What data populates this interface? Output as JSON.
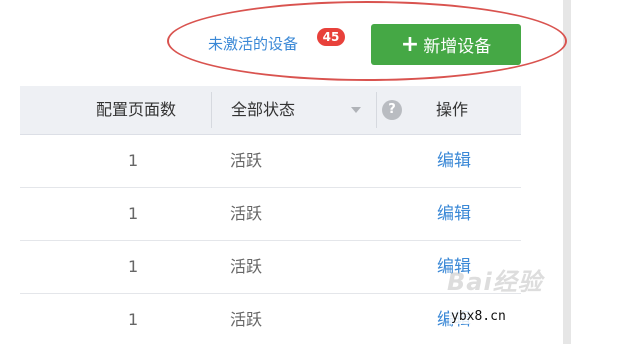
{
  "toolbar": {
    "inactive_link_label": "未激活的设备",
    "inactive_count": "45",
    "add_button_label": "新增设备"
  },
  "table": {
    "columns": {
      "pages": "配置页面数",
      "status": "全部状态",
      "help": "?",
      "actions": "操作"
    },
    "rows": [
      {
        "pages": "1",
        "status": "活跃",
        "action": "编辑"
      },
      {
        "pages": "1",
        "status": "活跃",
        "action": "编辑"
      },
      {
        "pages": "1",
        "status": "活跃",
        "action": "编辑"
      },
      {
        "pages": "1",
        "status": "活跃",
        "action": "编辑"
      }
    ]
  },
  "watermarks": {
    "brand": "Bai经验",
    "site": "ybx8.cn"
  },
  "colors": {
    "link": "#3a88d6",
    "button": "#45a845",
    "badge": "#e8413b",
    "annotation": "#d9534f",
    "header_bg": "#eef0f4"
  },
  "icons": {
    "add": "plus-icon",
    "filter": "caret-down-icon",
    "help": "question-circle-icon"
  }
}
